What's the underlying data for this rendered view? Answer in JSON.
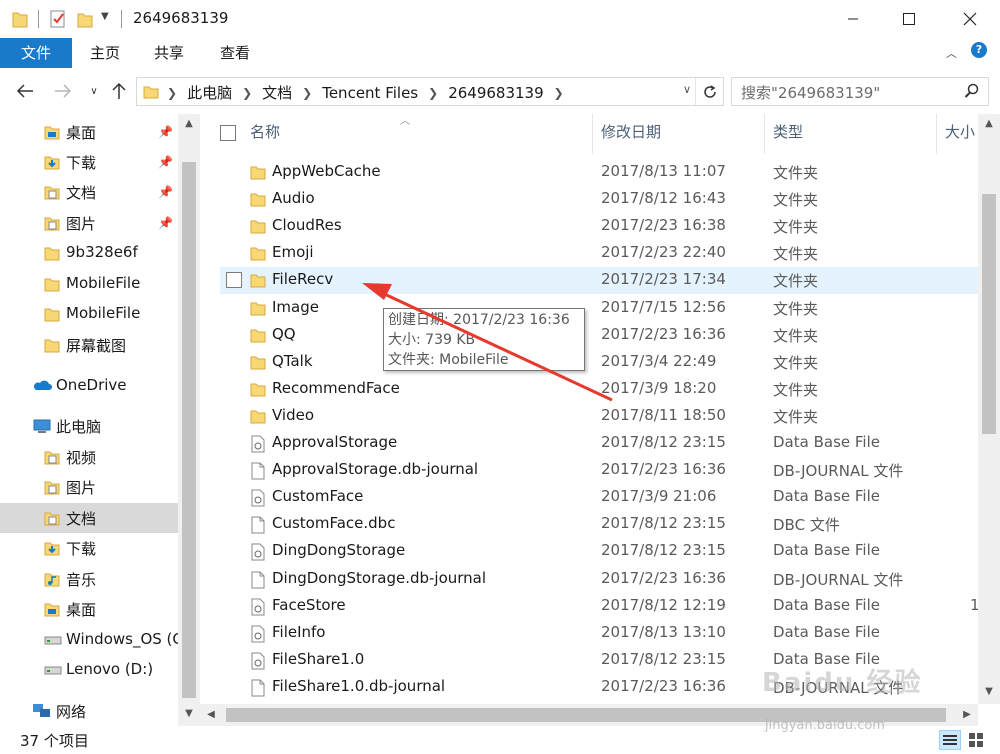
{
  "window": {
    "title": "2649683139",
    "minimize_icon": "minimize-icon",
    "maximize_icon": "maximize-icon",
    "close_icon": "close-icon"
  },
  "ribbon": {
    "tabs": [
      {
        "label": "文件"
      },
      {
        "label": "主页"
      },
      {
        "label": "共享"
      },
      {
        "label": "查看"
      }
    ]
  },
  "address": {
    "crumbs": [
      "此电脑",
      "文档",
      "Tencent Files",
      "2649683139"
    ]
  },
  "search": {
    "placeholder": "搜索\"2649683139\""
  },
  "nav": {
    "items": [
      {
        "label": "桌面",
        "icon": "desktop-folder-icon",
        "pinned": true
      },
      {
        "label": "下载",
        "icon": "download-folder-icon",
        "pinned": true
      },
      {
        "label": "文档",
        "icon": "documents-folder-icon",
        "pinned": true
      },
      {
        "label": "图片",
        "icon": "pictures-folder-icon",
        "pinned": true
      },
      {
        "label": "9b328e6f",
        "icon": "folder-icon",
        "pinned": false
      },
      {
        "label": "MobileFile",
        "icon": "folder-icon",
        "pinned": false
      },
      {
        "label": "MobileFile",
        "icon": "folder-icon",
        "pinned": false
      },
      {
        "label": "屏幕截图",
        "icon": "folder-icon",
        "pinned": false
      },
      {
        "label": "OneDrive",
        "icon": "onedrive-icon",
        "pinned": false
      },
      {
        "label": "此电脑",
        "icon": "this-pc-icon",
        "pinned": false
      },
      {
        "label": "视频",
        "icon": "videos-folder-icon",
        "pinned": false
      },
      {
        "label": "图片",
        "icon": "pictures-folder-icon",
        "pinned": false
      },
      {
        "label": "文档",
        "icon": "documents-folder-icon",
        "pinned": false
      },
      {
        "label": "下载",
        "icon": "download-folder-icon",
        "pinned": false
      },
      {
        "label": "音乐",
        "icon": "music-folder-icon",
        "pinned": false
      },
      {
        "label": "桌面",
        "icon": "desktop-folder-icon",
        "pinned": false
      },
      {
        "label": "Windows_OS (C",
        "icon": "drive-icon",
        "pinned": false
      },
      {
        "label": "Lenovo (D:)",
        "icon": "drive-icon",
        "pinned": false
      },
      {
        "label": "网络",
        "icon": "network-icon",
        "pinned": false
      }
    ]
  },
  "columns": {
    "name": "名称",
    "date": "修改日期",
    "type": "类型",
    "size": "大小"
  },
  "files": [
    {
      "name": "AppWebCache",
      "date": "2017/8/13 11:07",
      "type": "文件夹",
      "size": "",
      "kind": "folder"
    },
    {
      "name": "Audio",
      "date": "2017/8/12 16:43",
      "type": "文件夹",
      "size": "",
      "kind": "folder"
    },
    {
      "name": "CloudRes",
      "date": "2017/2/23 16:38",
      "type": "文件夹",
      "size": "",
      "kind": "folder"
    },
    {
      "name": "Emoji",
      "date": "2017/2/23 22:40",
      "type": "文件夹",
      "size": "",
      "kind": "folder"
    },
    {
      "name": "FileRecv",
      "date": "2017/2/23 17:34",
      "type": "文件夹",
      "size": "",
      "kind": "folder"
    },
    {
      "name": "Image",
      "date": "2017/7/15 12:56",
      "type": "文件夹",
      "size": "",
      "kind": "folder"
    },
    {
      "name": "QQ",
      "date": "2017/2/23 16:36",
      "type": "文件夹",
      "size": "",
      "kind": "folder"
    },
    {
      "name": "QTalk",
      "date": "2017/3/4 22:49",
      "type": "文件夹",
      "size": "",
      "kind": "folder"
    },
    {
      "name": "RecommendFace",
      "date": "2017/3/9 18:20",
      "type": "文件夹",
      "size": "",
      "kind": "folder"
    },
    {
      "name": "Video",
      "date": "2017/8/11 18:50",
      "type": "文件夹",
      "size": "",
      "kind": "folder"
    },
    {
      "name": "ApprovalStorage",
      "date": "2017/8/12 23:15",
      "type": "Data Base File",
      "size": "",
      "kind": "dbfile"
    },
    {
      "name": "ApprovalStorage.db-journal",
      "date": "2017/2/23 16:36",
      "type": "DB-JOURNAL 文件",
      "size": "",
      "kind": "file"
    },
    {
      "name": "CustomFace",
      "date": "2017/3/9 21:06",
      "type": "Data Base File",
      "size": "",
      "kind": "dbfile"
    },
    {
      "name": "CustomFace.dbc",
      "date": "2017/8/12 23:15",
      "type": "DBC 文件",
      "size": "",
      "kind": "file"
    },
    {
      "name": "DingDongStorage",
      "date": "2017/8/12 23:15",
      "type": "Data Base File",
      "size": "",
      "kind": "dbfile"
    },
    {
      "name": "DingDongStorage.db-journal",
      "date": "2017/2/23 16:36",
      "type": "DB-JOURNAL 文件",
      "size": "",
      "kind": "file"
    },
    {
      "name": "FaceStore",
      "date": "2017/8/12 12:19",
      "type": "Data Base File",
      "size": "1",
      "kind": "dbfile"
    },
    {
      "name": "FileInfo",
      "date": "2017/8/13 13:10",
      "type": "Data Base File",
      "size": "",
      "kind": "dbfile"
    },
    {
      "name": "FileShare1.0",
      "date": "2017/8/12 23:15",
      "type": "Data Base File",
      "size": "",
      "kind": "dbfile"
    },
    {
      "name": "FileShare1.0.db-journal",
      "date": "2017/2/23 16:36",
      "type": "DB-JOURNAL 文件",
      "size": "",
      "kind": "file"
    }
  ],
  "tooltip": {
    "line1": "创建日期: 2017/2/23 16:36",
    "line2": "大小: 739 KB",
    "line3": "文件夹: MobileFile"
  },
  "status": {
    "count": "37 个项目"
  },
  "watermark": {
    "text": "Baidu 经验",
    "url": "jingyan.baidu.com"
  },
  "colors": {
    "accent": "#1979ca",
    "folder": "#f8d775",
    "annotation_arrow": "#e8392f",
    "hover_row": "#e5f3ff"
  }
}
